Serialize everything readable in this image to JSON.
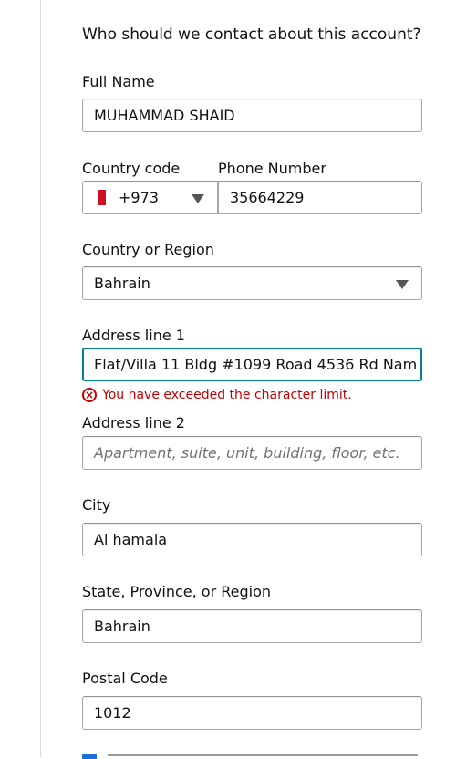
{
  "form": {
    "heading": "Who should we contact about this account?",
    "full_name": {
      "label": "Full Name",
      "value": "MUHAMMAD SHAID"
    },
    "country_code": {
      "label": "Country code",
      "value": "+973",
      "flag_icon": "bahrain-flag-icon"
    },
    "phone": {
      "label": "Phone Number",
      "value": "35664229"
    },
    "country_region": {
      "label": "Country or Region",
      "value": "Bahrain"
    },
    "address1": {
      "label": "Address line 1",
      "value": "Flat/Villa 11 Bldg #1099 Road 4536 Rd Nam",
      "error": "You have exceeded the character limit."
    },
    "address2": {
      "label": "Address line 2",
      "placeholder": "Apartment, suite, unit, building, floor, etc."
    },
    "city": {
      "label": "City",
      "value": "Al hamala"
    },
    "state": {
      "label": "State, Province, or Region",
      "value": "Bahrain"
    },
    "postal": {
      "label": "Postal Code",
      "value": "1012"
    }
  },
  "colors": {
    "focus_border": "#008296",
    "error": "#c40000",
    "border": "#a6a6a6"
  }
}
